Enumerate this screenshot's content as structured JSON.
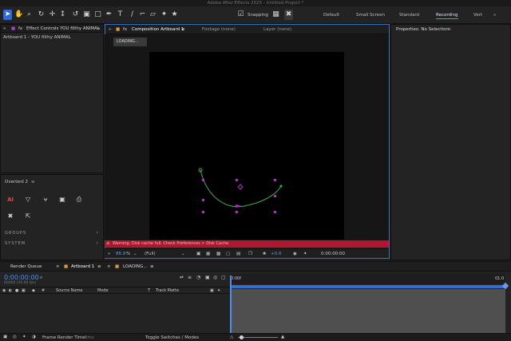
{
  "app": {
    "title": "Adobe After Effects 2025 - Untitled Project *"
  },
  "toolbar": {
    "snapping_label": "Snapping",
    "workspaces": [
      "Default",
      "Small Screen",
      "Standard",
      "Recording",
      "Vert"
    ],
    "active_workspace": "Recording"
  },
  "left_panel": {
    "tab_label": "Effect Controls YOU filthy ANIMAL",
    "subtitle": "Artboard 1 - YOU filthy ANIMAL"
  },
  "viewer": {
    "tabs": {
      "composition": "Composition Artboard 1",
      "footage": "Footage (none)",
      "layer": "Layer (none)"
    },
    "loading_label": "LOADING...",
    "error_text": "Warning: Disk cache full. Check Preferences > Disk Cache.",
    "zoom": "86.9",
    "zoom_unit": "%",
    "resolution": "(Full)",
    "exposure": "+0.0",
    "timecode": "0:00:00:00"
  },
  "overlord": {
    "title": "Overlord 2",
    "sections": [
      "GROUPS",
      "SYSTEM"
    ]
  },
  "properties": {
    "title": "Properties: No Selection"
  },
  "timeline": {
    "tabs": {
      "render_queue": "Render Queue",
      "artboard": "Artboard 1",
      "loading": "LOADING..."
    },
    "timecode": "0:00:00:00",
    "timecode_sub": "00000 (30.00 fps)",
    "columns": {
      "source_name": "Source Name",
      "mode": "Mode",
      "t": "T",
      "track_matte": "Track Matte"
    },
    "ruler_start": "0:00f",
    "ruler_end": "01:0"
  },
  "status": {
    "frame_render_label": "Frame Render Time:",
    "frame_render_value": "0ms",
    "toggle_label": "Toggle Switches / Modes"
  },
  "colors": {
    "accent": "#2d6bd6",
    "error": "#b0162f",
    "path": "#3fae5a",
    "handle": "#b52cc8"
  }
}
